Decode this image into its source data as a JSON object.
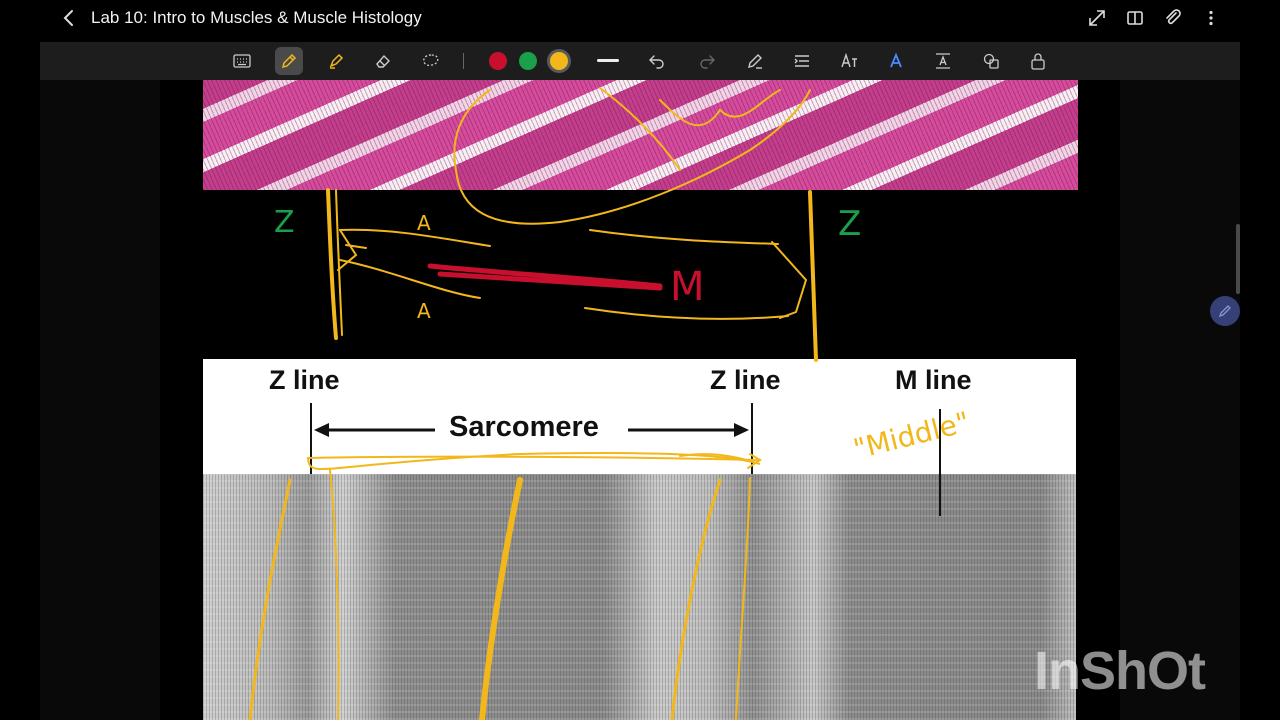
{
  "app_bar": {
    "title": "Lab 10: Intro to Muscles & Muscle Histology",
    "back_icon": "chevron-left-icon",
    "actions": [
      "expand-icon",
      "split-view-icon",
      "attachment-icon",
      "more-vert-icon"
    ]
  },
  "toolbar": {
    "tools": [
      "keyboard-icon",
      "pen-icon",
      "highlighter-icon",
      "eraser-icon",
      "lasso-icon",
      "undo-icon",
      "redo-icon",
      "pen-settings-icon",
      "text-layout-icon",
      "text-icon",
      "text-style-icon",
      "spacing-icon",
      "shapes-icon",
      "lock-icon"
    ],
    "active_tool": "pen",
    "pen_colors": [
      "#c8102e",
      "#1aa04b",
      "#f2b71a"
    ],
    "selected_color": "#f2b71a",
    "stroke_weight_label": "stroke-width-icon"
  },
  "canvas": {
    "em_labels": {
      "z_line_left": "Z line",
      "z_line_right": "Z line",
      "m_line": "M line",
      "sarcomere": "Sarcomere"
    },
    "handwriting": {
      "z_left": "Z",
      "z_right": "Z",
      "a_top": "A",
      "a_bottom": "A",
      "m": "M",
      "middle": "\"Middle\""
    },
    "ink_colors": {
      "yellow": "#f2b71a",
      "green": "#1aa04b",
      "red": "#c8102e"
    }
  },
  "watermark": "InShOt"
}
